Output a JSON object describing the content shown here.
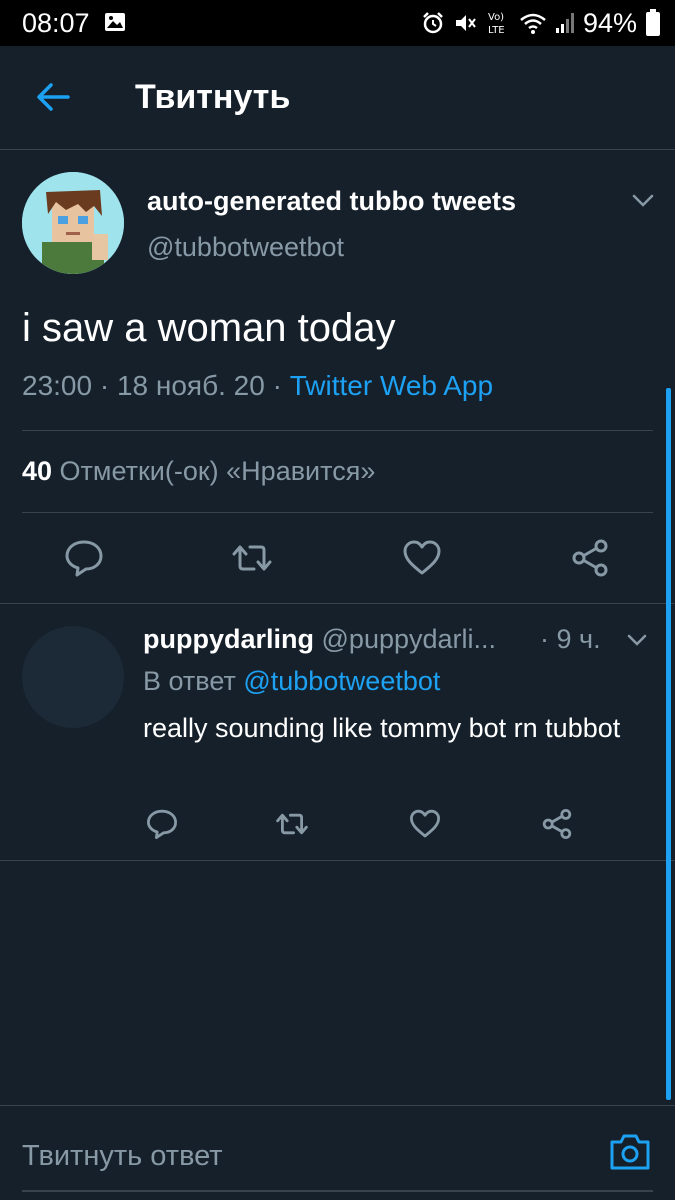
{
  "status_bar": {
    "time": "08:07",
    "battery": "94%",
    "icons": [
      "image-icon",
      "alarm-icon",
      "mute-icon",
      "volte-icon",
      "wifi-icon",
      "signal-icon",
      "battery-icon"
    ]
  },
  "header": {
    "title": "Твитнуть",
    "back_icon": "arrow-left-icon"
  },
  "tweet": {
    "display_name": "auto-generated tubbo tweets",
    "handle": "@tubbotweetbot",
    "text": "i saw a woman today",
    "time": "23:00 · 18 нояб. 20 · ",
    "source": "Twitter Web App",
    "likes_count": "40",
    "likes_label": " Отметки(-ок) «Нравится»",
    "actions": [
      "reply-icon",
      "retweet-icon",
      "like-icon",
      "share-icon"
    ]
  },
  "reply": {
    "display_name": "puppydarling",
    "handle": "@puppydarli...",
    "time": "· 9 ч.",
    "reply_to_label": "В ответ ",
    "reply_to_mention": "@tubbotweetbot",
    "text": "really sounding like tommy bot rn tubbot"
  },
  "composer": {
    "placeholder": "Твитнуть ответ",
    "camera_icon": "camera-icon"
  },
  "colors": {
    "background": "#15202b",
    "accent": "#1da1f2",
    "secondary_text": "#8899a6",
    "divider": "#38444d"
  }
}
